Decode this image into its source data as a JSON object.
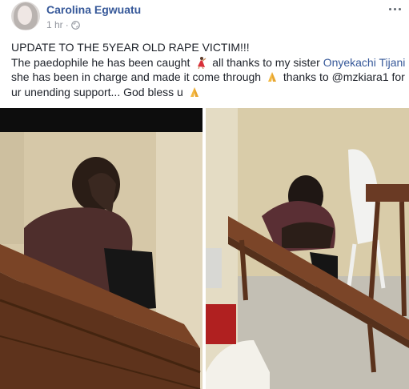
{
  "post": {
    "author": "Carolina Egwuatu",
    "time": "1 hr",
    "separator": "·",
    "privacy_icon": "globe-icon",
    "more_icon": "ellipsis-icon",
    "text": {
      "line1": "UPDATE TO THE 5YEAR OLD RAPE VICTIM!!!",
      "line2_a": "The paedophile he has been caught",
      "line2_b": "all thanks to my sister",
      "line2_link": "Onyekachi Tijani",
      "line3_a": "she has been in charge and made it come through",
      "line3_b": "thanks to @mzkiara1 for",
      "line4_a": "ur unending support... God bless u",
      "emoji_1": "dancer-emoji",
      "emoji_2": "folded-hands-emoji"
    },
    "photos": [
      {
        "name": "photo-left",
        "description_icon": "photo"
      },
      {
        "name": "photo-right",
        "description_icon": "photo"
      }
    ]
  },
  "colors": {
    "link": "#365899",
    "text": "#1d2129",
    "meta": "#90949c",
    "wall": "#d9ccae",
    "bench": "#6b3c22"
  }
}
